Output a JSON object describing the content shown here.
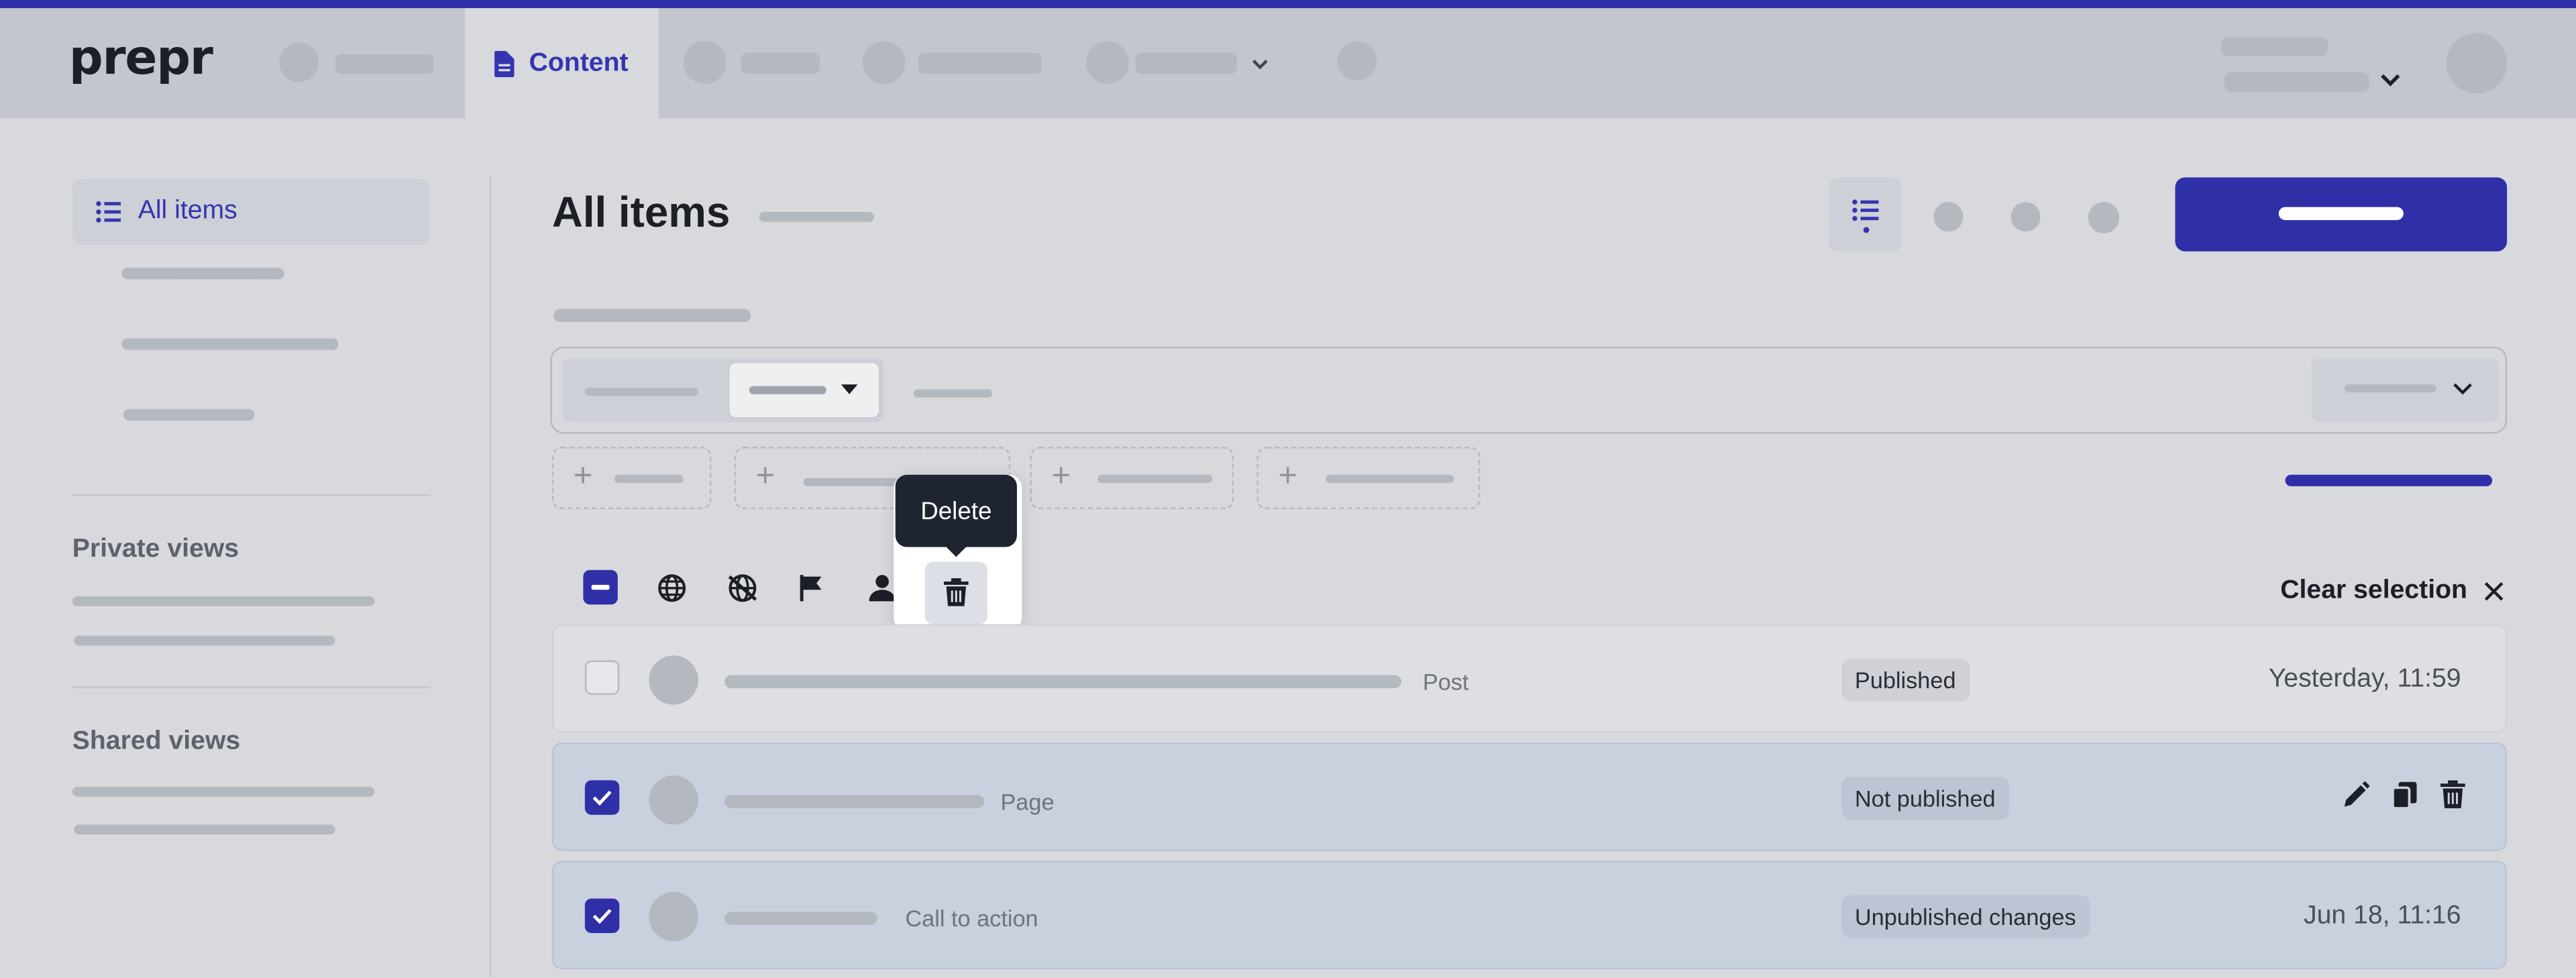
{
  "app": {
    "logo": "prepr",
    "active_tab": "Content"
  },
  "sidebar": {
    "all_items_label": "All items",
    "private_views_heading": "Private views",
    "shared_views_heading": "Shared views"
  },
  "main": {
    "title": "All items"
  },
  "tooltip": {
    "label": "Delete"
  },
  "toolbar": {
    "clear_selection_label": "Clear selection"
  },
  "rows": [
    {
      "type": "Post",
      "status": "Published",
      "date": "Yesterday, 11:59",
      "checked": false
    },
    {
      "type": "Page",
      "status": "Not published",
      "date": "",
      "checked": true
    },
    {
      "type": "Call to action",
      "status": "Unpublished changes",
      "date": "Jun 18, 11:16",
      "checked": true
    }
  ],
  "icons": {
    "content_tab": "document-icon",
    "all_items": "list-icon",
    "list_view": "list-icon",
    "publish": "globe-icon",
    "unpublish": "globe-off-icon",
    "flag": "flag-icon",
    "assign": "person-icon",
    "delete": "trash-icon",
    "clear": "close-icon",
    "edit": "pencil-icon",
    "duplicate": "copy-icon"
  },
  "colors": {
    "accent": "#2f2fa8",
    "topbar": "#c3c6cc",
    "background": "#d8d9dd",
    "tooltip": "#1f2530",
    "selected_row": "#c9d0de"
  }
}
